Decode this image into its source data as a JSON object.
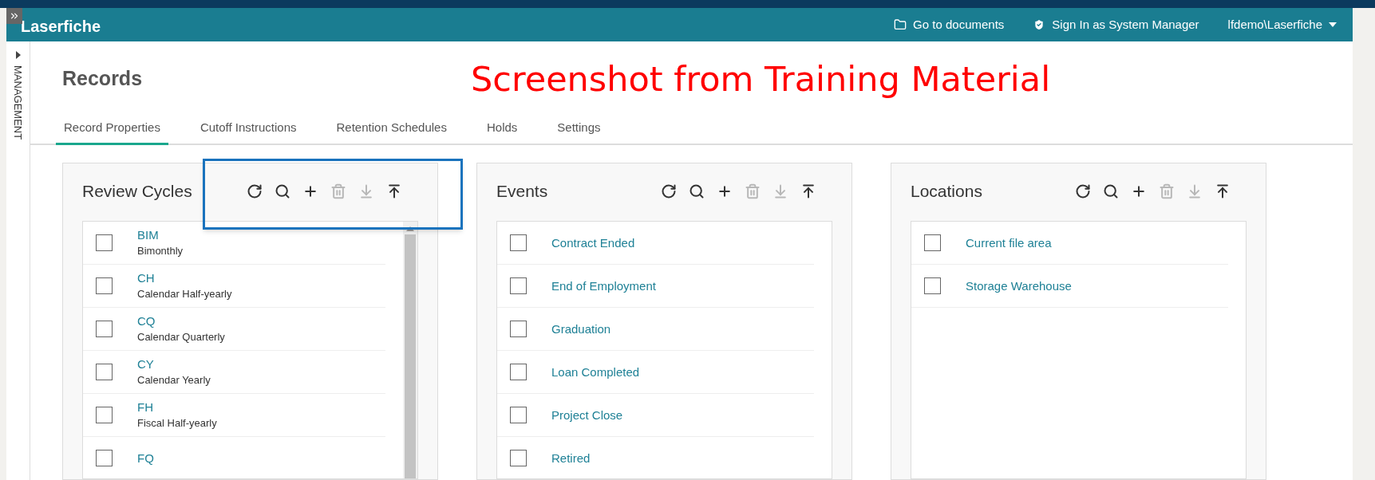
{
  "header": {
    "logo": "Laserfiche",
    "links": [
      {
        "kind": "folder",
        "label": "Go to documents"
      },
      {
        "kind": "shield",
        "label": "Sign In as System Manager"
      },
      {
        "kind": "user",
        "label": "lfdemo\\Laserfiche"
      }
    ]
  },
  "sidebar": {
    "label": "MANAGEMENT",
    "expanded": false
  },
  "page": {
    "title": "Records",
    "annotation": "Screenshot from Training Material"
  },
  "tabs": [
    {
      "label": "Record Properties",
      "selected": true
    },
    {
      "label": "Cutoff Instructions",
      "selected": false
    },
    {
      "label": "Retention Schedules",
      "selected": false
    },
    {
      "label": "Holds",
      "selected": false
    },
    {
      "label": "Settings",
      "selected": false
    }
  ],
  "panels": [
    {
      "title": "Review Cycles",
      "highlighted": true,
      "scrollbar": true,
      "toolbar": [
        {
          "kind": "refresh",
          "disabled": false
        },
        {
          "kind": "search",
          "disabled": false
        },
        {
          "kind": "add",
          "disabled": false
        },
        {
          "kind": "delete",
          "disabled": true
        },
        {
          "kind": "download",
          "disabled": true
        },
        {
          "kind": "upload",
          "disabled": false
        }
      ],
      "items": [
        {
          "code": "BIM",
          "description": "Bimonthly",
          "checked": false
        },
        {
          "code": "CH",
          "description": "Calendar Half-yearly",
          "checked": false
        },
        {
          "code": "CQ",
          "description": "Calendar Quarterly",
          "checked": false
        },
        {
          "code": "CY",
          "description": "Calendar Yearly",
          "checked": false
        },
        {
          "code": "FH",
          "description": "Fiscal Half-yearly",
          "checked": false
        },
        {
          "code": "FQ",
          "checked": false
        }
      ]
    },
    {
      "title": "Events",
      "highlighted": false,
      "scrollbar": false,
      "toolbar": [
        {
          "kind": "refresh",
          "disabled": false
        },
        {
          "kind": "search",
          "disabled": false
        },
        {
          "kind": "add",
          "disabled": false
        },
        {
          "kind": "delete",
          "disabled": true
        },
        {
          "kind": "download",
          "disabled": true
        },
        {
          "kind": "upload",
          "disabled": false
        }
      ],
      "items": [
        {
          "code": "Contract Ended",
          "checked": false
        },
        {
          "code": "End of Employment",
          "checked": false
        },
        {
          "code": "Graduation",
          "checked": false
        },
        {
          "code": "Loan Completed",
          "checked": false
        },
        {
          "code": "Project Close",
          "checked": false
        },
        {
          "code": "Retired",
          "checked": false
        }
      ]
    },
    {
      "title": "Locations",
      "highlighted": false,
      "scrollbar": false,
      "toolbar": [
        {
          "kind": "refresh",
          "disabled": false
        },
        {
          "kind": "search",
          "disabled": false
        },
        {
          "kind": "add",
          "disabled": false
        },
        {
          "kind": "delete",
          "disabled": true
        },
        {
          "kind": "download",
          "disabled": true
        },
        {
          "kind": "upload",
          "disabled": false
        }
      ],
      "items": [
        {
          "code": "Current file area",
          "checked": false
        },
        {
          "code": "Storage Warehouse",
          "checked": false
        }
      ]
    }
  ]
}
